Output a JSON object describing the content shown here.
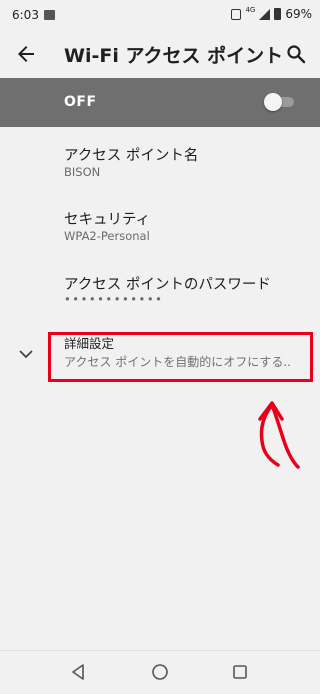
{
  "status_bar": {
    "time": "6:03",
    "network": "4G",
    "battery": "69%"
  },
  "app_bar": {
    "title": "Wi-Fi アクセス ポイント",
    "icons": [
      "back-arrow-icon",
      "search-icon"
    ]
  },
  "hotspot_toggle": {
    "label": "OFF",
    "state": "off"
  },
  "preferences": [
    {
      "title": "アクセス ポイント名",
      "summary": "BISON"
    },
    {
      "title": "セキュリティ",
      "summary": "WPA2-Personal"
    },
    {
      "title": "アクセス ポイントのパスワード",
      "summary": "••••••••••••"
    },
    {
      "title": "詳細設定",
      "summary": "アクセス ポイントを自動的にオフにする.."
    }
  ],
  "colors": {
    "toggle_bar": "#6f6f6f",
    "background": "#f1f1f1",
    "annotation": "#e8001a"
  },
  "nav_bar": {
    "icons": [
      "nav-back-icon",
      "nav-home-icon",
      "nav-recents-icon"
    ]
  }
}
